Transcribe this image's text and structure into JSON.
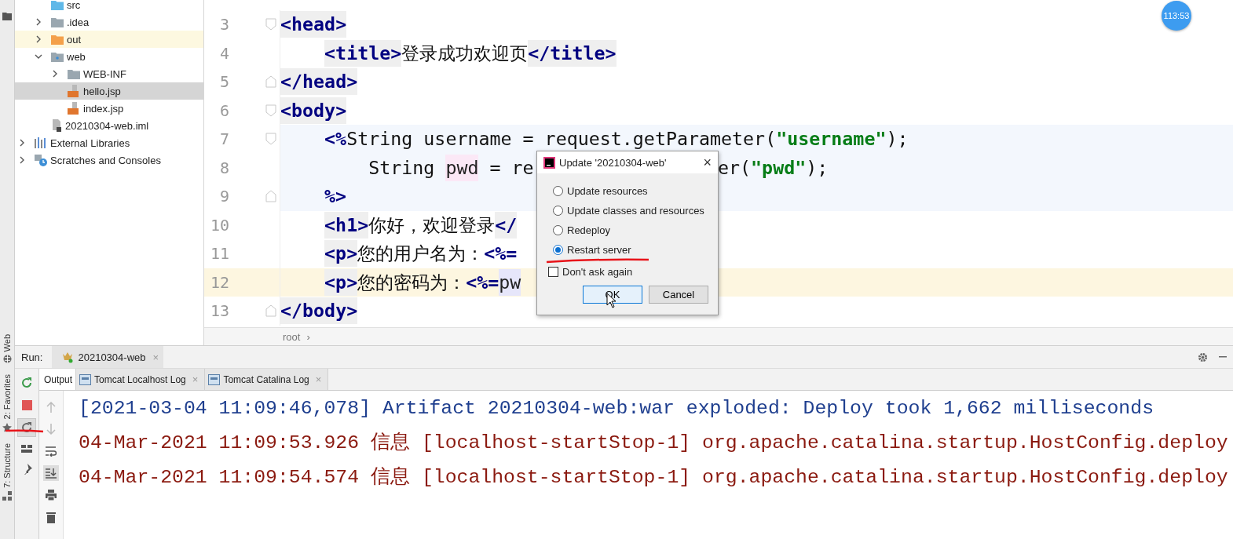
{
  "tool_strip": {
    "labels": [
      {
        "text": "Web",
        "kind": "globe"
      },
      {
        "text": "2: Favorites",
        "kind": "star"
      },
      {
        "text": "7: Structure",
        "kind": "structure"
      }
    ]
  },
  "project_tree": {
    "module_children": [
      {
        "label": "src",
        "kind": "folder-source",
        "selected": false
      },
      {
        "label": ".idea",
        "kind": "folder",
        "expanded": false,
        "selected": false
      },
      {
        "label": "out",
        "kind": "folder-excluded",
        "expanded": false,
        "selected": false
      },
      {
        "label": "web",
        "kind": "folder-web",
        "expanded": true,
        "selected": false,
        "children": [
          {
            "label": "WEB-INF",
            "kind": "folder",
            "expanded": false,
            "selected": false
          },
          {
            "label": "hello.jsp",
            "kind": "jsp",
            "selected": true
          },
          {
            "label": "index.jsp",
            "kind": "jsp",
            "selected": false
          }
        ]
      },
      {
        "label": "20210304-web.iml",
        "kind": "iml",
        "selected": false
      }
    ],
    "roots": [
      {
        "label": "External Libraries",
        "kind": "libraries",
        "expanded": false,
        "selected": false
      },
      {
        "label": "Scratches and Consoles",
        "kind": "scratches",
        "expanded": false,
        "selected": false
      }
    ]
  },
  "editor": {
    "lines": [
      {
        "number": "3",
        "kind": "fold-start",
        "injected": false,
        "current": false,
        "tokens": [
          {
            "kind": "tag",
            "text": "<head>"
          }
        ],
        "children": [
          {
            "number": "4",
            "injected": false,
            "current": false,
            "tokens": [
              {
                "kind": "tag",
                "text": "<title>"
              },
              {
                "kind": "text",
                "text": "登录成功欢迎页"
              },
              {
                "kind": "tag",
                "text": "</title>"
              }
            ]
          }
        ]
      },
      {
        "number": "5",
        "kind": "fold-end",
        "injected": false,
        "current": false,
        "tokens": [
          {
            "kind": "tag",
            "text": "</head>"
          }
        ]
      },
      {
        "number": "6",
        "kind": "fold-start",
        "injected": false,
        "current": false,
        "tokens": [
          {
            "kind": "tag",
            "text": "<body>"
          }
        ],
        "children": [
          {
            "number": "7",
            "kind": "fold-start",
            "injected": true,
            "current": false,
            "tokens": [
              {
                "kind": "jsp",
                "text": "<%"
              },
              {
                "kind": "code",
                "text": "String username = request.getParameter("
              },
              {
                "kind": "string",
                "text": "\"username\""
              },
              {
                "kind": "code",
                "text": ");"
              }
            ],
            "children": [
              {
                "number": "8",
                "injected": true,
                "current": false,
                "tokens": [
                  {
                    "kind": "code",
                    "text": "String "
                  },
                  {
                    "kind": "usage",
                    "text": "pwd"
                  },
                  {
                    "kind": "code",
                    "text": " = re"
                  }
                ],
                "tail": [
                  {
                    "kind": "code",
                    "text": "er("
                  },
                  {
                    "kind": "string",
                    "text": "\"pwd\""
                  },
                  {
                    "kind": "code",
                    "text": ");"
                  }
                ]
              }
            ]
          },
          {
            "number": "9",
            "kind": "fold-end",
            "injected": true,
            "current": false,
            "tokens": [
              {
                "kind": "jsp",
                "text": "%>"
              }
            ]
          },
          {
            "number": "10",
            "injected": false,
            "current": false,
            "tokens": [
              {
                "kind": "tag",
                "text": "<h1>"
              },
              {
                "kind": "text",
                "text": "你好，欢迎登录"
              },
              {
                "kind": "tag",
                "text": "</"
              }
            ]
          },
          {
            "number": "11",
            "injected": false,
            "current": false,
            "tokens": [
              {
                "kind": "tag",
                "text": "<p>"
              },
              {
                "kind": "text",
                "text": "您的用户名为："
              },
              {
                "kind": "jsp",
                "text": "<%="
              }
            ]
          },
          {
            "number": "12",
            "injected": false,
            "current": true,
            "tokens": [
              {
                "kind": "tag",
                "text": "<p>"
              },
              {
                "kind": "text",
                "text": "您的密码为："
              },
              {
                "kind": "jsp",
                "text": "<%="
              },
              {
                "kind": "injected",
                "text": "pw"
              }
            ]
          }
        ]
      },
      {
        "number": "13",
        "kind": "fold-end",
        "injected": false,
        "current": false,
        "tokens": [
          {
            "kind": "tag",
            "text": "</body>"
          }
        ]
      }
    ],
    "breadcrumb": "root",
    "breadcrumb_separator": "›"
  },
  "timer_badge": "113:53",
  "dialog": {
    "title": "Update '20210304-web'",
    "close": "×",
    "options": [
      {
        "label": "Update resources",
        "selected": false
      },
      {
        "label": "Update classes and resources",
        "selected": false
      },
      {
        "label": "Redeploy",
        "selected": false
      },
      {
        "label": "Restart server",
        "selected": true
      }
    ],
    "dont_ask": {
      "label": "Don't ask again",
      "checked": false
    },
    "buttons": [
      {
        "label": "OK",
        "default": true
      },
      {
        "label": "Cancel",
        "default": false
      }
    ]
  },
  "run_panel": {
    "title": "Run:",
    "config_tab": {
      "label": "20210304-web",
      "close": "×"
    },
    "tabs": [
      {
        "label": "Output",
        "selected": true
      },
      {
        "label": "Tomcat Localhost Log",
        "selected": false,
        "close": "×"
      },
      {
        "label": "Tomcat Catalina Log",
        "selected": false,
        "close": "×"
      }
    ],
    "console": [
      {
        "kind": "system",
        "text": "[2021-03-04 11:09:46,078] Artifact 20210304-web:war exploded: Deploy took 1,662 milliseconds"
      },
      {
        "kind": "log",
        "text": "04-Mar-2021 11:09:53.926 信息 [localhost-startStop-1] org.apache.catalina.startup.HostConfig.deploy"
      },
      {
        "kind": "log",
        "text": "04-Mar-2021 11:09:54.574 信息 [localhost-startStop-1] org.apache.catalina.startup.HostConfig.deploy"
      }
    ]
  }
}
